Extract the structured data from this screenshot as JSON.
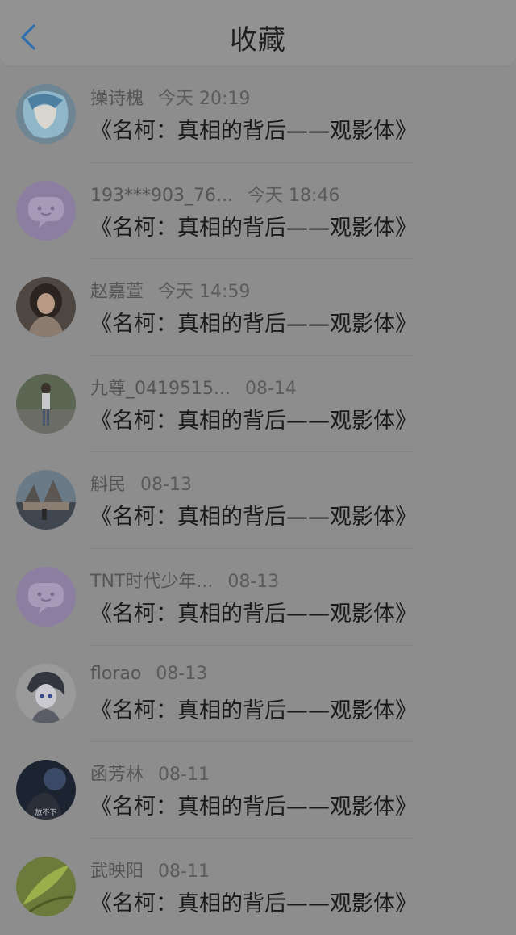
{
  "header": {
    "title": "收藏"
  },
  "items": [
    {
      "user": "操诗槐",
      "time": "今天 20:19",
      "text": "《名柯：真相的背后——观影体》",
      "avatar": "anime-blue"
    },
    {
      "user": "193***903_76...",
      "time": "今天 18:46",
      "text": "《名柯：真相的背后——观影体》",
      "avatar": "default-chat"
    },
    {
      "user": "赵嘉萱",
      "time": "今天 14:59",
      "text": "《名柯：真相的背后——观影体》",
      "avatar": "photo-girl"
    },
    {
      "user": "九尊_0419515...",
      "time": "08-14",
      "text": "《名柯：真相的背后——观影体》",
      "avatar": "photo-outdoor"
    },
    {
      "user": "斛民",
      "time": "08-13",
      "text": "《名柯：真相的背后——观影体》",
      "avatar": "photo-building"
    },
    {
      "user": "TNT时代少年...",
      "time": "08-13",
      "text": "《名柯：真相的背后——观影体》",
      "avatar": "default-chat"
    },
    {
      "user": "florao",
      "time": "08-13",
      "text": "《名柯：真相的背后——观影体》",
      "avatar": "anime-sketch"
    },
    {
      "user": "函芳林",
      "time": "08-11",
      "text": "《名柯：真相的背后——观影体》",
      "avatar": "dark-photo",
      "avatar_caption": "放不下"
    },
    {
      "user": "武映阳",
      "time": "08-11",
      "text": "《名柯：真相的背后——观影体》",
      "avatar": "green-leaf"
    }
  ],
  "colors": {
    "back_icon": "#2f6fb0",
    "chat_avatar": "#8b7ea0"
  }
}
